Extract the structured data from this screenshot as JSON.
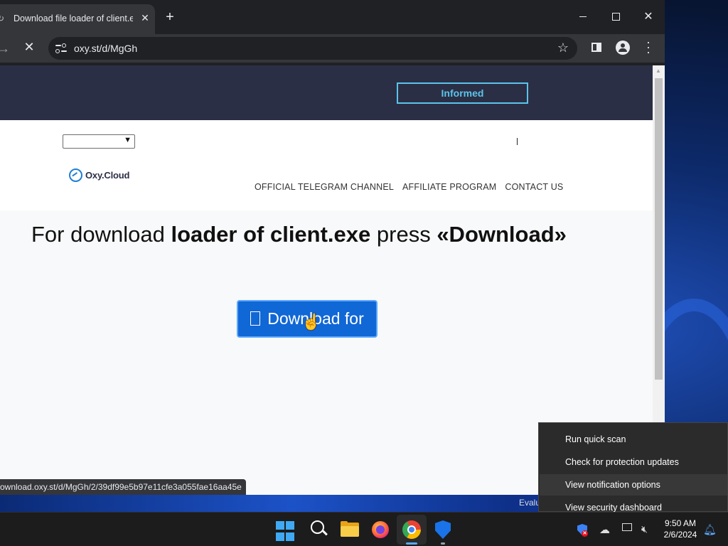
{
  "browser": {
    "tab_title": "Download file loader of client.e",
    "new_tab_label": "+",
    "url": "oxy.st/d/MgGh",
    "status_url": "ownload.oxy.st/d/MgGh/2/39df99e5b97e11cfe3a055fae16aa45e"
  },
  "site": {
    "header_button": "Informed",
    "logo_text": "Oxy.Cloud",
    "nav_links": [
      "OFFICIAL TELEGRAM CHANNEL",
      "AFFILIATE PROGRAM",
      "CONTACT US"
    ],
    "headline": {
      "part1": "For download ",
      "part2": "loader of client.exe",
      "part3": " press ",
      "part4": "«Download»"
    },
    "download_button": "Download for"
  },
  "context_menu": {
    "items": [
      "Run quick scan",
      "Check for protection updates",
      "View notification options",
      "View security dashboard"
    ],
    "highlighted_index": 2
  },
  "desktop": {
    "watermark_text": "Evalu"
  },
  "taskbar": {
    "apps": [
      "start-icon",
      "search-icon",
      "file-explorer-icon",
      "firefox-icon",
      "chrome-icon",
      "defender-icon"
    ],
    "time": "9:50 AM",
    "date": "2/6/2024"
  },
  "colors": {
    "site_header": "#2b2f45",
    "informed_accent": "#5bc4ec",
    "download_button": "#1067d6",
    "logo_blue": "#1e7fd8"
  }
}
